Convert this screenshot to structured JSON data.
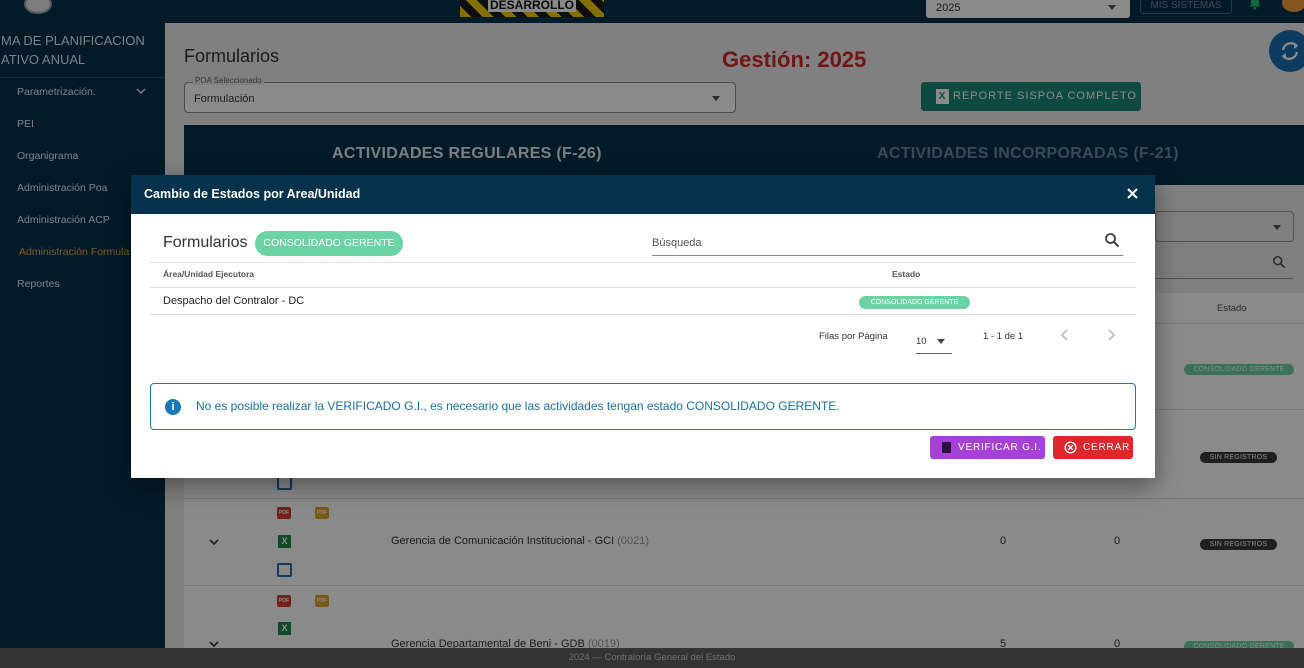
{
  "topbar": {
    "env_badge": "DESARROLLO",
    "year_select": "2025",
    "mis_sistemas": "MIS SISTEMAS"
  },
  "sidebar": {
    "system_title_line1": "MA DE PLANIFICACION",
    "system_title_line2": "ATIVO ANUAL",
    "items": [
      {
        "label": "Parametrización."
      },
      {
        "label": "PEI"
      },
      {
        "label": "Organigrama"
      },
      {
        "label": "Administración Poa"
      },
      {
        "label": "Administración ACP"
      },
      {
        "label": "Administración Formula"
      },
      {
        "label": "Reportes"
      }
    ]
  },
  "main": {
    "title": "Formularios",
    "gestion": "Gestión: 2025",
    "poa_legend": "POA Seleccionado",
    "poa_value": "Formulación",
    "reporte_button": "REPORTE SISPOA COMPLETO",
    "tabs": [
      {
        "label": "ACTIVIDADES REGULARES (F-26)"
      },
      {
        "label": "ACTIVIDADES INCORPORADAS (F-21)"
      }
    ],
    "col_estado": "Estado",
    "rows": [
      {
        "name": "",
        "code": "",
        "n1": "",
        "n2": "",
        "estado": "CONSOLIDADO GERENTE"
      },
      {
        "name": "",
        "code": "",
        "n1": "",
        "n2": "",
        "estado": "SIN REGISTROS"
      },
      {
        "name": "Gerencia de Comunicación Institucional - GCI",
        "code": "(0021)",
        "n1": "0",
        "n2": "0",
        "estado": "SIN REGISTROS"
      },
      {
        "name": "Gerencia Departamental de Beni - GDB",
        "code": "(0019)",
        "n1": "5",
        "n2": "0",
        "estado": "CONSOLIDADO GERENTE"
      }
    ],
    "pdf_label": "PDF",
    "excel_label": "X"
  },
  "modal": {
    "title": "Cambio de Estados por Area/Unidad",
    "heading": "Formularios",
    "heading_badge": "CONSOLIDADO GERENTE",
    "search_placeholder": "Búsqueda",
    "columns": [
      "Área/Unidad Ejecutora",
      "Estado"
    ],
    "rows": [
      {
        "unidad": "Despacho del Contralor - DC",
        "estado": "CONSOLIDADO GERENTE"
      }
    ],
    "rows_per_page_label": "Filas por Página",
    "rows_per_page": "10",
    "range": "1 - 1 de 1",
    "alert_icon": "i",
    "alert": "No es posible realizar la VERIFICADO G.I., es necesario que las actividades tengan estado CONSOLIDADO GERENTE.",
    "verify_button": "VERIFICAR G.I.",
    "close_button": "CERRAR"
  },
  "footer": "2024 — Contraloría General del Estado",
  "colors": {
    "navy": "#06324d",
    "accent_red": "#d1272b",
    "teal": "#1b8a79",
    "badge_green": "#6bd3a4",
    "purple": "#a541d9",
    "danger": "#e0262c",
    "info_blue": "#1a79b8"
  }
}
